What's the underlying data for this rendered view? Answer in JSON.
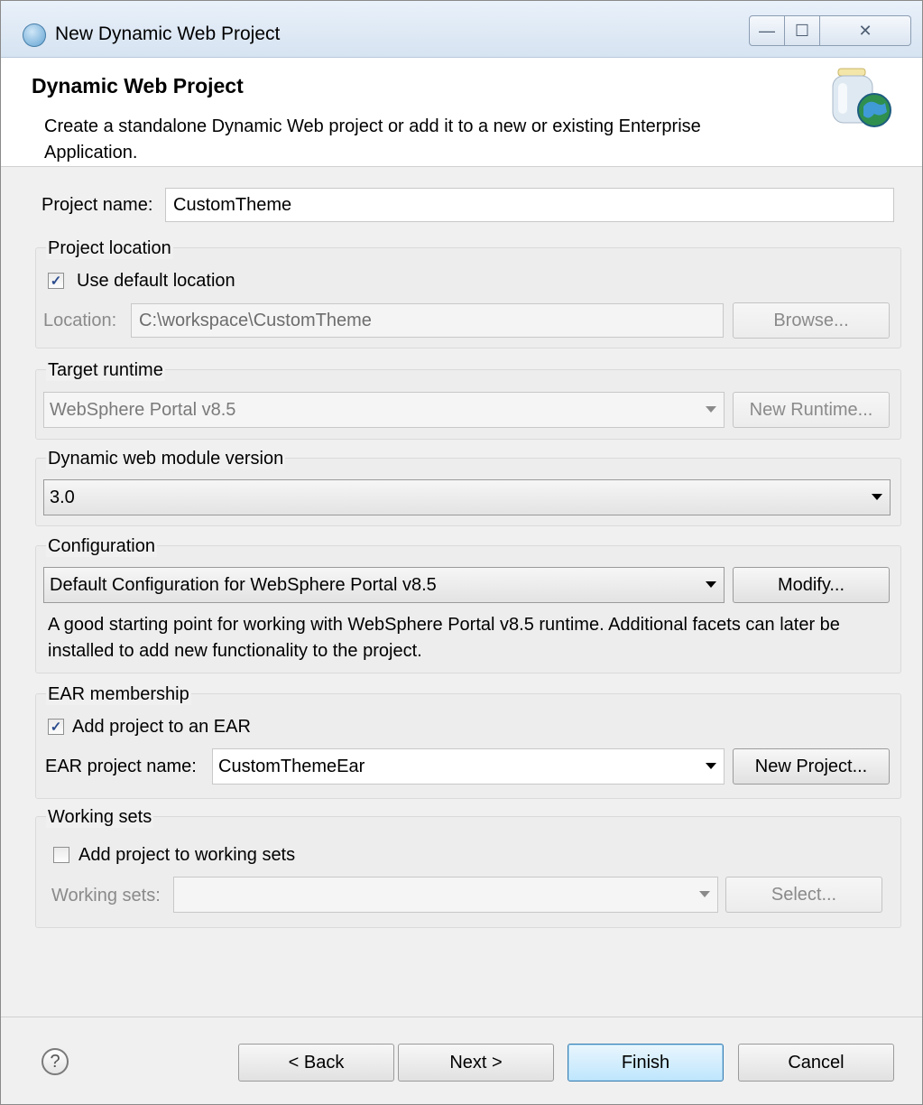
{
  "window": {
    "title": "New Dynamic Web Project",
    "minimize_glyph": "—",
    "maximize_glyph": "☐",
    "close_glyph": "✕"
  },
  "banner": {
    "title": "Dynamic Web Project",
    "description": "Create a standalone Dynamic Web project or add it to a new or existing Enterprise Application.",
    "icon": "web-project-jar-globe-icon"
  },
  "project_name": {
    "label": "Project name:",
    "value": "CustomTheme"
  },
  "project_location": {
    "group_title": "Project location",
    "use_default_label": "Use default location",
    "use_default_checked": true,
    "location_label": "Location:",
    "location_value": "C:\\workspace\\CustomTheme",
    "browse_label": "Browse..."
  },
  "target_runtime": {
    "group_title": "Target runtime",
    "selected": "WebSphere Portal v8.5",
    "new_runtime_label": "New Runtime..."
  },
  "web_module": {
    "group_title": "Dynamic web module version",
    "selected": "3.0"
  },
  "configuration": {
    "group_title": "Configuration",
    "selected": "Default Configuration for WebSphere Portal v8.5",
    "modify_label": "Modify...",
    "description": "A good starting point for working with WebSphere Portal v8.5 runtime. Additional facets can later be installed to add new functionality to the project."
  },
  "ear_membership": {
    "group_title": "EAR membership",
    "add_to_ear_label": "Add project to an EAR",
    "add_to_ear_checked": true,
    "ear_name_label": "EAR project name:",
    "ear_name_value": "CustomThemeEar",
    "new_project_label": "New Project..."
  },
  "working_sets": {
    "group_title": "Working sets",
    "add_label": "Add project to working sets",
    "add_checked": false,
    "sets_label": "Working sets:",
    "sets_value": "",
    "select_label": "Select..."
  },
  "footer": {
    "help_glyph": "?",
    "back_label": "< Back",
    "next_label": "Next >",
    "finish_label": "Finish",
    "cancel_label": "Cancel"
  },
  "check_glyph": "✓"
}
